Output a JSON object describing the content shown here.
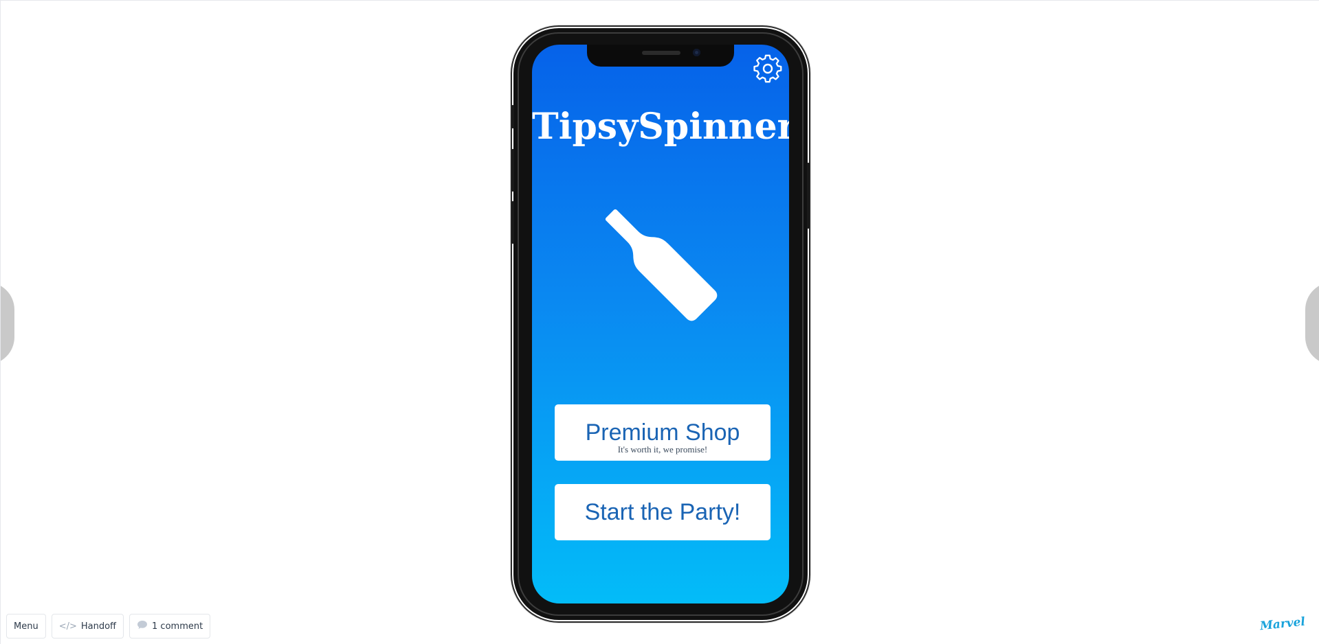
{
  "prototype": {
    "nav_prev_icon": "chevron-left",
    "nav_next_icon": "chevron-right"
  },
  "app": {
    "title": "TipsySpinner",
    "settings_icon": "gear",
    "bottle_icon": "bottle",
    "colors": {
      "gradient_top": "#0662e9",
      "gradient_bottom": "#03bcf8",
      "button_text": "#1a64b4"
    },
    "premium_button": {
      "label": "Premium Shop",
      "sublabel": "It's worth it, we promise!"
    },
    "start_button": {
      "label": "Start the Party!"
    }
  },
  "toolbar": {
    "menu_label": "Menu",
    "handoff_label": "Handoff",
    "handoff_icon": "code-icon",
    "comments_label": "1 comment",
    "comments_icon": "comment-bubble"
  },
  "branding": {
    "logo_text": "Marvel"
  }
}
